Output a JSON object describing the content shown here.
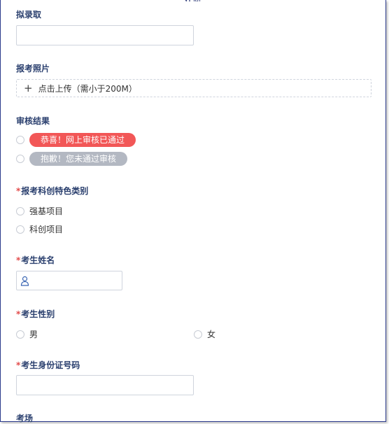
{
  "header": {
    "cut_title": "欢迎"
  },
  "fields": {
    "admission": {
      "label": "拟录取",
      "value": ""
    },
    "photo": {
      "label": "报考照片",
      "upload_text": "点击上传（需小于200M）"
    },
    "review": {
      "label": "审核结果",
      "options": [
        "恭喜！网上审核已通过",
        "抱歉！您未通过审核"
      ]
    },
    "category": {
      "required_mark": "*",
      "label": "报考科创特色类别",
      "options": [
        "强基项目",
        "科创项目"
      ]
    },
    "name": {
      "required_mark": "*",
      "label": "考生姓名",
      "value": ""
    },
    "gender": {
      "required_mark": "*",
      "label": "考生性别",
      "options": [
        "男",
        "女"
      ]
    },
    "id_number": {
      "required_mark": "*",
      "label": "考生身份证号码",
      "value": ""
    },
    "venue": {
      "label": "考场"
    }
  },
  "colors": {
    "label": "#2a3f6e",
    "required": "#e34b4b",
    "pass_pill": "#f25757",
    "fail_pill": "#b3b8c2",
    "frame": "#2b3a8c"
  }
}
